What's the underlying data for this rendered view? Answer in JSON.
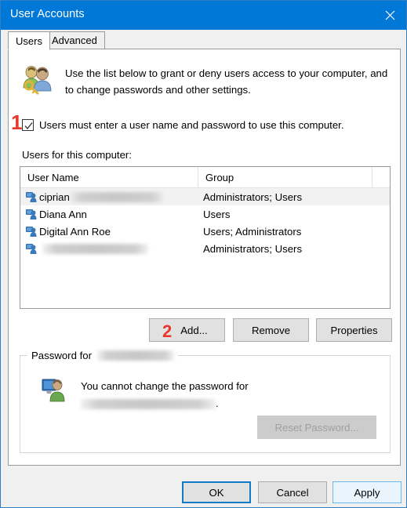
{
  "window": {
    "title": "User Accounts",
    "close_icon": "close-icon"
  },
  "tabs": [
    {
      "label": "Users",
      "selected": true
    },
    {
      "label": "Advanced",
      "selected": false
    }
  ],
  "header": {
    "icon": "users-key-icon",
    "text": "Use the list below to grant or deny users access to your computer, and to change passwords and other settings."
  },
  "checkbox": {
    "label": "Users must enter a user name and password to use this computer.",
    "checked": true
  },
  "annotations": [
    {
      "number": "1",
      "target": "require-password-checkbox",
      "color": "#e8372b"
    },
    {
      "number": "2",
      "target": "add-button",
      "color": "#e8372b"
    }
  ],
  "list": {
    "caption": "Users for this computer:",
    "columns": [
      "User Name",
      "Group",
      ""
    ],
    "rows": [
      {
        "name": "ciprian",
        "name_redacted": true,
        "redact_width": 118,
        "group": "Administrators; Users",
        "selected": true
      },
      {
        "name": "Diana Ann",
        "name_redacted": false,
        "redact_width": 0,
        "group": "Users",
        "selected": false
      },
      {
        "name": "Digital Ann Roe",
        "name_redacted": false,
        "redact_width": 0,
        "group": "Users; Administrators",
        "selected": false
      },
      {
        "name": "",
        "name_redacted": true,
        "redact_width": 135,
        "group": "Administrators; Users",
        "selected": false
      }
    ]
  },
  "actions": {
    "add": "Add...",
    "remove": "Remove",
    "properties": "Properties"
  },
  "password_group": {
    "legend": "Password for",
    "legend_redacted": true,
    "legend_redact_width": 98,
    "icon": "user-monitor-icon",
    "message_line1": "You cannot change the password for",
    "message_line2_redacted": true,
    "message_line2_redact_width": 172,
    "message_line2_suffix": ".",
    "reset_button": "Reset Password...",
    "reset_button_enabled": false
  },
  "footer": {
    "ok": "OK",
    "cancel": "Cancel",
    "apply": "Apply"
  },
  "colors": {
    "titlebar": "#0078d7",
    "accent_focus": "#0f7ac7",
    "apply_border": "#6cb8e8",
    "annotation_red": "#e8372b"
  }
}
